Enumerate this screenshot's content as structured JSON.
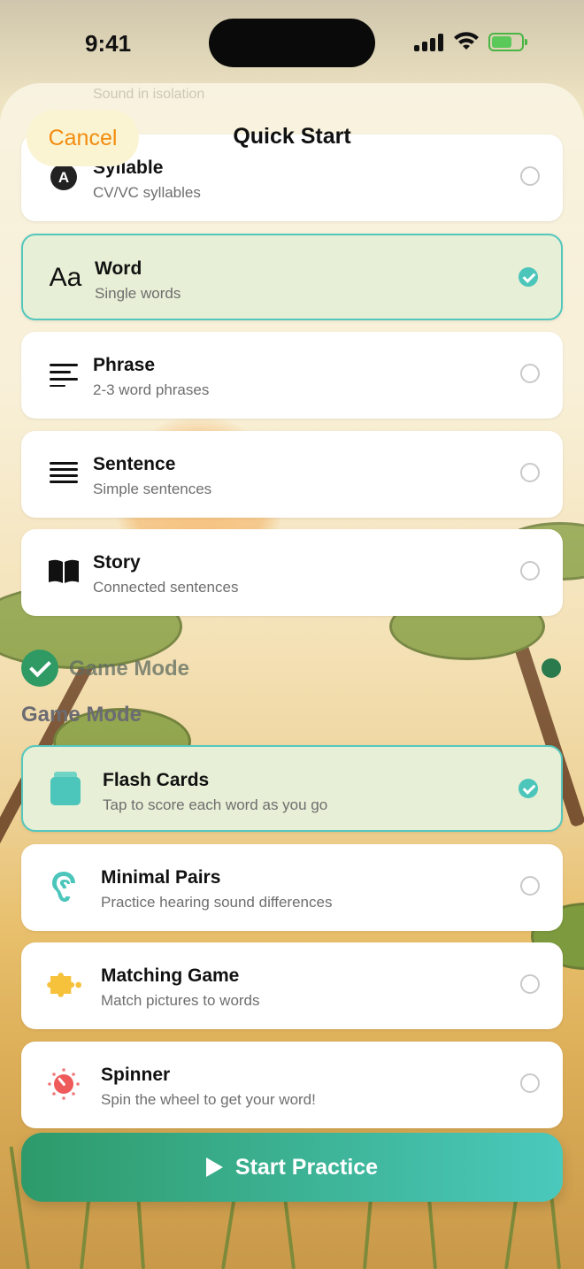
{
  "status_bar": {
    "time": "9:41",
    "battery_level": 0.7
  },
  "header": {
    "cancel_label": "Cancel",
    "title": "Quick Start",
    "ghost_text": "Sound in isolation"
  },
  "levels": [
    {
      "icon": "letter-a-icon",
      "label": "Syllable",
      "sub": "CV/VC syllables",
      "selected": false
    },
    {
      "icon": "text-size-icon",
      "icon_text": "Aa",
      "label": "Word",
      "sub": "Single words",
      "selected": true
    },
    {
      "icon": "short-lines-icon",
      "label": "Phrase",
      "sub": "2-3 word phrases",
      "selected": false
    },
    {
      "icon": "paragraph-lines-icon",
      "label": "Sentence",
      "sub": "Simple sentences",
      "selected": false
    },
    {
      "icon": "open-book-icon",
      "label": "Story",
      "sub": "Connected sentences",
      "selected": false
    }
  ],
  "section": {
    "faded_title": "Game Mode",
    "title": "Game Mode"
  },
  "games": [
    {
      "icon": "cards-icon",
      "label": "Flash Cards",
      "sub": "Tap to score each word as you go",
      "selected": true
    },
    {
      "icon": "ear-icon",
      "label": "Minimal Pairs",
      "sub": "Practice hearing sound differences",
      "selected": false
    },
    {
      "icon": "puzzle-icon",
      "label": "Matching Game",
      "sub": "Match pictures to words",
      "selected": false
    },
    {
      "icon": "spinner-dial-icon",
      "label": "Spinner",
      "sub": "Spin the wheel to get your word!",
      "selected": false
    }
  ],
  "cta": {
    "label": "Start Practice"
  },
  "colors": {
    "accent_orange": "#f28c0f",
    "teal": "#4cc5bb",
    "green": "#2e9a6a",
    "selected_bg": "#e7efd6"
  }
}
